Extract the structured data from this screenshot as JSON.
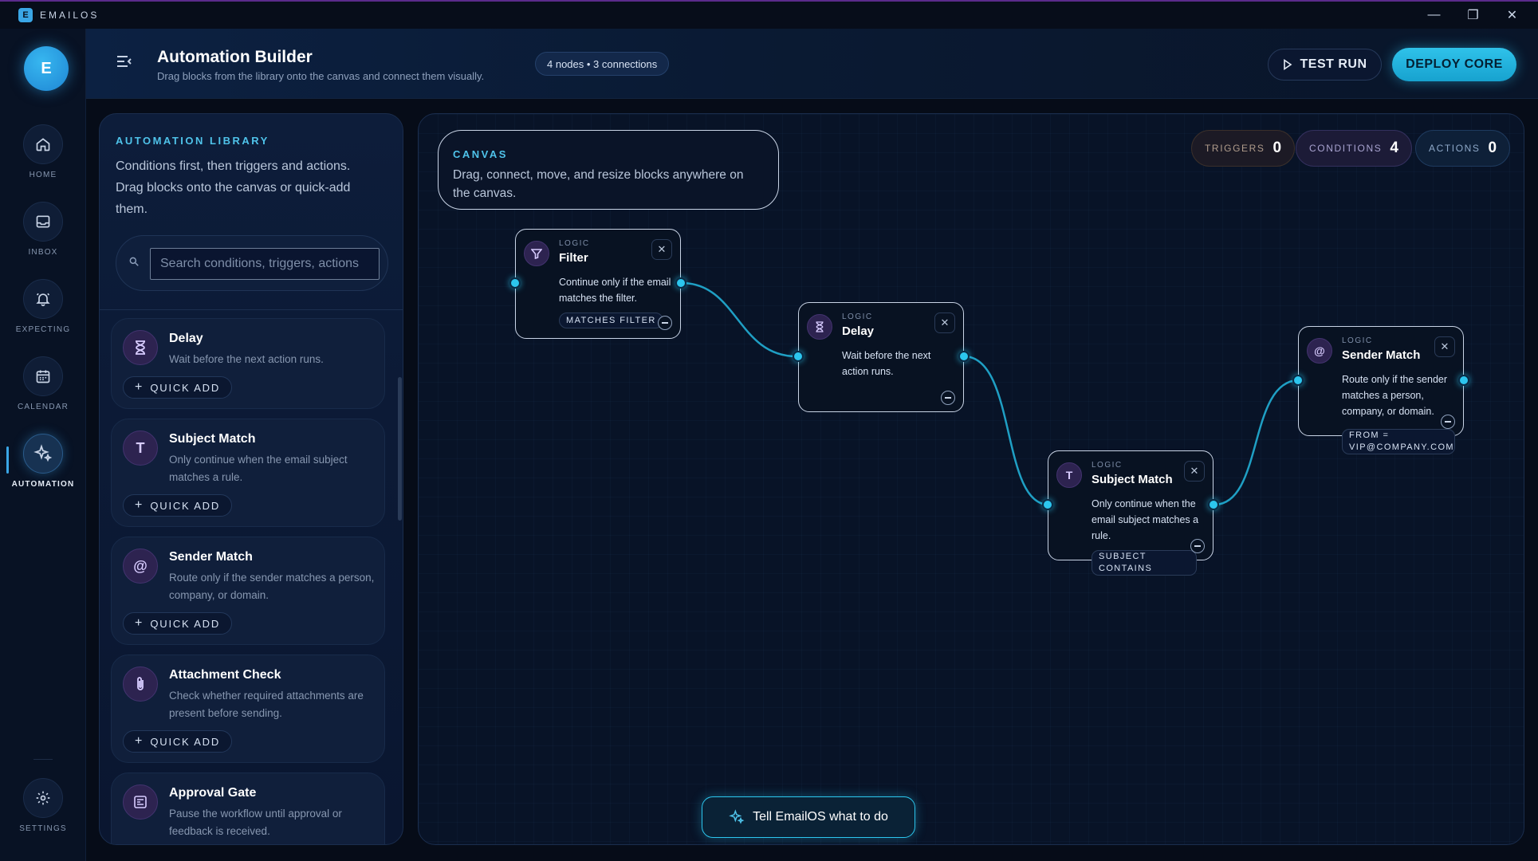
{
  "app": {
    "logo_letter": "E",
    "name": "EMAILOS"
  },
  "window": {
    "minimize": "—",
    "maximize": "❐",
    "close": "✕"
  },
  "rail": {
    "avatar": "E",
    "items": [
      {
        "label": "HOME",
        "icon": "home-icon"
      },
      {
        "label": "INBOX",
        "icon": "inbox-icon"
      },
      {
        "label": "EXPECTING",
        "icon": "bell-icon"
      },
      {
        "label": "CALENDAR",
        "icon": "calendar-icon"
      },
      {
        "label": "AUTOMATION",
        "icon": "sparkles-icon",
        "active": true
      }
    ],
    "settings_label": "SETTINGS"
  },
  "header": {
    "title": "Automation Builder",
    "subtitle": "Drag blocks from the library onto the canvas and connect them visually.",
    "stats": "4 nodes • 3 connections",
    "test_run": "TEST RUN",
    "deploy": "DEPLOY CORE"
  },
  "library": {
    "heading": "AUTOMATION LIBRARY",
    "description": "Conditions first, then triggers and actions. Drag blocks onto the canvas or quick-add them.",
    "search_placeholder": "Search conditions, triggers, actions",
    "quick_add": "QUICK ADD",
    "items": [
      {
        "title": "Delay",
        "desc": "Wait before the next action runs.",
        "icon": "hourglass-icon"
      },
      {
        "title": "Subject Match",
        "desc": "Only continue when the email subject matches a rule.",
        "icon": "text-t-icon",
        "glyph": "T"
      },
      {
        "title": "Sender Match",
        "desc": "Route only if the sender matches a person, company, or domain.",
        "icon": "at-icon",
        "glyph": "@"
      },
      {
        "title": "Attachment Check",
        "desc": "Check whether required attachments are present before sending.",
        "icon": "paperclip-icon"
      },
      {
        "title": "Approval Gate",
        "desc": "Pause the workflow until approval or feedback is received.",
        "icon": "form-icon"
      }
    ]
  },
  "canvas": {
    "label": "CANVAS",
    "description": "Drag, connect, move, and resize blocks anywhere on the canvas.",
    "counts": {
      "triggers_label": "TRIGGERS",
      "triggers": "0",
      "conditions_label": "CONDITIONS",
      "conditions": "4",
      "actions_label": "ACTIONS",
      "actions": "0"
    },
    "nodes": [
      {
        "kicker": "LOGIC",
        "title": "Filter",
        "desc": "Continue only if the email matches the filter.",
        "tag": "MATCHES FILTER",
        "icon": "funnel-icon"
      },
      {
        "kicker": "LOGIC",
        "title": "Delay",
        "desc": "Wait before the next action runs.",
        "tag": "",
        "icon": "hourglass-icon"
      },
      {
        "kicker": "LOGIC",
        "title": "Subject Match",
        "desc": "Only continue when the email subject matches a rule.",
        "tag": "SUBJECT CONTAINS",
        "icon": "text-t-icon",
        "glyph": "T"
      },
      {
        "kicker": "LOGIC",
        "title": "Sender Match",
        "desc": "Route only if the sender matches a person, company, or domain.",
        "tag": "FROM = VIP@COMPANY.COM",
        "icon": "at-icon",
        "glyph": "@"
      }
    ],
    "ask_button": "Tell EmailOS what to do"
  },
  "colors": {
    "accent": "#2cc6ee",
    "brand": "#3aa6e6",
    "node_icon_bg": "#2d2350"
  }
}
